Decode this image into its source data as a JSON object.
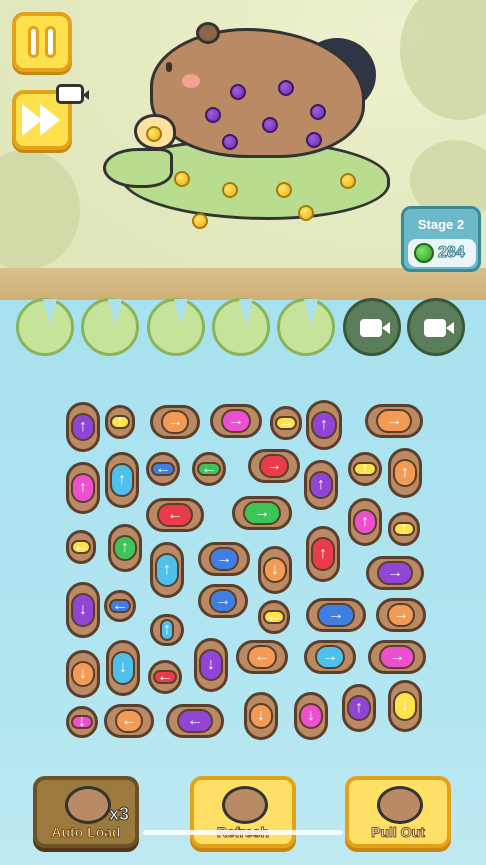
{
  "hud": {
    "pause_icon": "pause-icon",
    "fast_forward_icon": "fast-forward-icon",
    "video_icon": "video-icon"
  },
  "stage": {
    "label": "Stage 2",
    "coins": "284"
  },
  "colors": {
    "orange": "#f39a55",
    "pink": "#ee4fcf",
    "yellow": "#ffe24a",
    "purple": "#9145d6",
    "cyan": "#4ec0ec",
    "blue": "#3f7fe4",
    "green": "#3cc65a",
    "red": "#ea3c48"
  },
  "lily_pads": [
    {
      "state": "empty"
    },
    {
      "state": "empty"
    },
    {
      "state": "empty"
    },
    {
      "state": "empty"
    },
    {
      "state": "empty"
    },
    {
      "state": "locked",
      "icon": "video-icon"
    },
    {
      "state": "locked",
      "icon": "video-icon"
    }
  ],
  "pieces": [
    {
      "c": "purple",
      "d": "up"
    },
    {
      "c": "yellow",
      "d": "up"
    },
    {
      "c": "orange",
      "d": "right"
    },
    {
      "c": "pink",
      "d": "right"
    },
    {
      "c": "yellow",
      "d": "right"
    },
    {
      "c": "purple",
      "d": "up"
    },
    {
      "c": "orange",
      "d": "right"
    },
    {
      "c": "pink",
      "d": "up"
    },
    {
      "c": "cyan",
      "d": "up"
    },
    {
      "c": "blue",
      "d": "left"
    },
    {
      "c": "green",
      "d": "left"
    },
    {
      "c": "red",
      "d": "right"
    },
    {
      "c": "purple",
      "d": "up"
    },
    {
      "c": "yellow",
      "d": "up"
    },
    {
      "c": "orange",
      "d": "up"
    },
    {
      "c": "red",
      "d": "left"
    },
    {
      "c": "green",
      "d": "right"
    },
    {
      "c": "pink",
      "d": "up"
    },
    {
      "c": "yellow",
      "d": "up"
    },
    {
      "c": "yellow",
      "d": "left"
    },
    {
      "c": "green",
      "d": "up"
    },
    {
      "c": "cyan",
      "d": "up"
    },
    {
      "c": "blue",
      "d": "right"
    },
    {
      "c": "orange",
      "d": "down"
    },
    {
      "c": "red",
      "d": "up"
    },
    {
      "c": "purple",
      "d": "right"
    },
    {
      "c": "purple",
      "d": "down"
    },
    {
      "c": "blue",
      "d": "left"
    },
    {
      "c": "blue",
      "d": "right"
    },
    {
      "c": "yellow",
      "d": "left"
    },
    {
      "c": "blue",
      "d": "right"
    },
    {
      "c": "orange",
      "d": "right"
    },
    {
      "c": "cyan",
      "d": "up"
    },
    {
      "c": "orange",
      "d": "down"
    },
    {
      "c": "cyan",
      "d": "down"
    },
    {
      "c": "red",
      "d": "left"
    },
    {
      "c": "purple",
      "d": "down"
    },
    {
      "c": "orange",
      "d": "left"
    },
    {
      "c": "cyan",
      "d": "right"
    },
    {
      "c": "pink",
      "d": "right"
    },
    {
      "c": "pink",
      "d": "down"
    },
    {
      "c": "orange",
      "d": "left"
    },
    {
      "c": "purple",
      "d": "left"
    },
    {
      "c": "orange",
      "d": "down"
    },
    {
      "c": "pink",
      "d": "down"
    },
    {
      "c": "purple",
      "d": "up"
    },
    {
      "c": "yellow",
      "d": "down"
    }
  ],
  "buttons": {
    "auto_load": {
      "label": "Auto Load",
      "count": "x3"
    },
    "refresh": {
      "label": "Refresh"
    },
    "pull_out": {
      "label": "Pull Out"
    }
  }
}
